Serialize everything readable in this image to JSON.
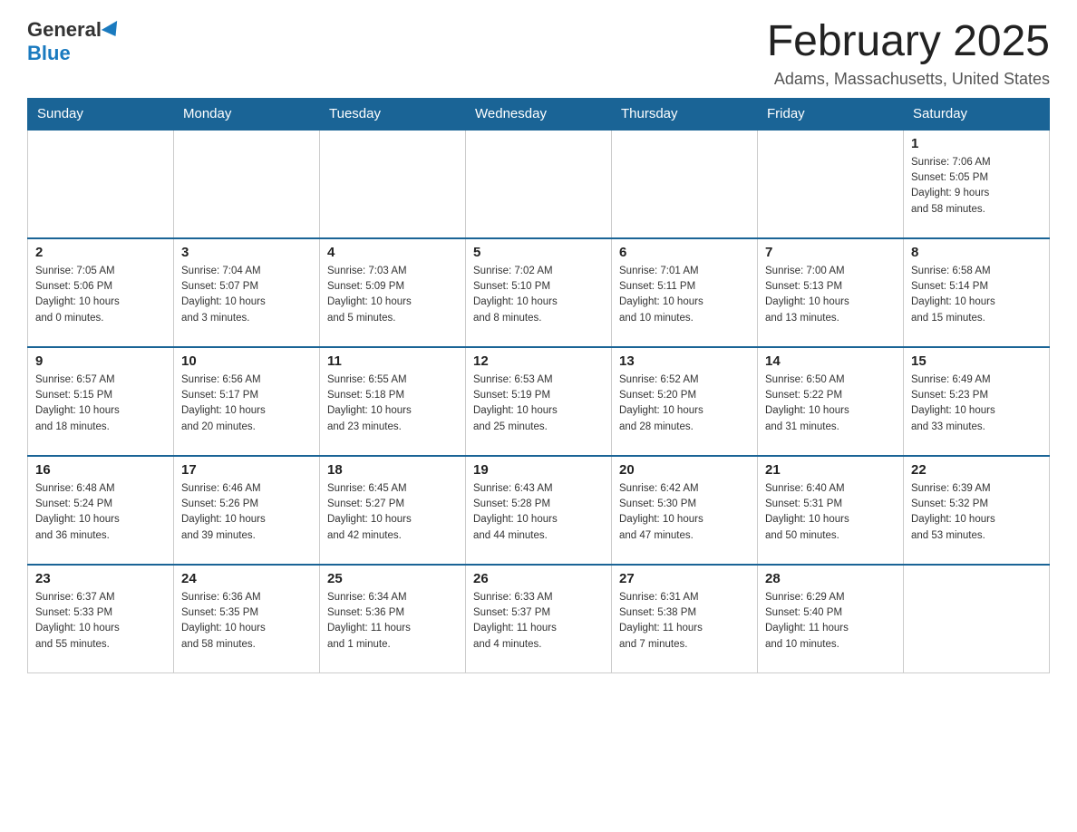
{
  "header": {
    "logo_general": "General",
    "logo_blue": "Blue",
    "month_title": "February 2025",
    "location": "Adams, Massachusetts, United States"
  },
  "days_of_week": [
    "Sunday",
    "Monday",
    "Tuesday",
    "Wednesday",
    "Thursday",
    "Friday",
    "Saturday"
  ],
  "weeks": [
    [
      {
        "day": "",
        "info": ""
      },
      {
        "day": "",
        "info": ""
      },
      {
        "day": "",
        "info": ""
      },
      {
        "day": "",
        "info": ""
      },
      {
        "day": "",
        "info": ""
      },
      {
        "day": "",
        "info": ""
      },
      {
        "day": "1",
        "info": "Sunrise: 7:06 AM\nSunset: 5:05 PM\nDaylight: 9 hours\nand 58 minutes."
      }
    ],
    [
      {
        "day": "2",
        "info": "Sunrise: 7:05 AM\nSunset: 5:06 PM\nDaylight: 10 hours\nand 0 minutes."
      },
      {
        "day": "3",
        "info": "Sunrise: 7:04 AM\nSunset: 5:07 PM\nDaylight: 10 hours\nand 3 minutes."
      },
      {
        "day": "4",
        "info": "Sunrise: 7:03 AM\nSunset: 5:09 PM\nDaylight: 10 hours\nand 5 minutes."
      },
      {
        "day": "5",
        "info": "Sunrise: 7:02 AM\nSunset: 5:10 PM\nDaylight: 10 hours\nand 8 minutes."
      },
      {
        "day": "6",
        "info": "Sunrise: 7:01 AM\nSunset: 5:11 PM\nDaylight: 10 hours\nand 10 minutes."
      },
      {
        "day": "7",
        "info": "Sunrise: 7:00 AM\nSunset: 5:13 PM\nDaylight: 10 hours\nand 13 minutes."
      },
      {
        "day": "8",
        "info": "Sunrise: 6:58 AM\nSunset: 5:14 PM\nDaylight: 10 hours\nand 15 minutes."
      }
    ],
    [
      {
        "day": "9",
        "info": "Sunrise: 6:57 AM\nSunset: 5:15 PM\nDaylight: 10 hours\nand 18 minutes."
      },
      {
        "day": "10",
        "info": "Sunrise: 6:56 AM\nSunset: 5:17 PM\nDaylight: 10 hours\nand 20 minutes."
      },
      {
        "day": "11",
        "info": "Sunrise: 6:55 AM\nSunset: 5:18 PM\nDaylight: 10 hours\nand 23 minutes."
      },
      {
        "day": "12",
        "info": "Sunrise: 6:53 AM\nSunset: 5:19 PM\nDaylight: 10 hours\nand 25 minutes."
      },
      {
        "day": "13",
        "info": "Sunrise: 6:52 AM\nSunset: 5:20 PM\nDaylight: 10 hours\nand 28 minutes."
      },
      {
        "day": "14",
        "info": "Sunrise: 6:50 AM\nSunset: 5:22 PM\nDaylight: 10 hours\nand 31 minutes."
      },
      {
        "day": "15",
        "info": "Sunrise: 6:49 AM\nSunset: 5:23 PM\nDaylight: 10 hours\nand 33 minutes."
      }
    ],
    [
      {
        "day": "16",
        "info": "Sunrise: 6:48 AM\nSunset: 5:24 PM\nDaylight: 10 hours\nand 36 minutes."
      },
      {
        "day": "17",
        "info": "Sunrise: 6:46 AM\nSunset: 5:26 PM\nDaylight: 10 hours\nand 39 minutes."
      },
      {
        "day": "18",
        "info": "Sunrise: 6:45 AM\nSunset: 5:27 PM\nDaylight: 10 hours\nand 42 minutes."
      },
      {
        "day": "19",
        "info": "Sunrise: 6:43 AM\nSunset: 5:28 PM\nDaylight: 10 hours\nand 44 minutes."
      },
      {
        "day": "20",
        "info": "Sunrise: 6:42 AM\nSunset: 5:30 PM\nDaylight: 10 hours\nand 47 minutes."
      },
      {
        "day": "21",
        "info": "Sunrise: 6:40 AM\nSunset: 5:31 PM\nDaylight: 10 hours\nand 50 minutes."
      },
      {
        "day": "22",
        "info": "Sunrise: 6:39 AM\nSunset: 5:32 PM\nDaylight: 10 hours\nand 53 minutes."
      }
    ],
    [
      {
        "day": "23",
        "info": "Sunrise: 6:37 AM\nSunset: 5:33 PM\nDaylight: 10 hours\nand 55 minutes."
      },
      {
        "day": "24",
        "info": "Sunrise: 6:36 AM\nSunset: 5:35 PM\nDaylight: 10 hours\nand 58 minutes."
      },
      {
        "day": "25",
        "info": "Sunrise: 6:34 AM\nSunset: 5:36 PM\nDaylight: 11 hours\nand 1 minute."
      },
      {
        "day": "26",
        "info": "Sunrise: 6:33 AM\nSunset: 5:37 PM\nDaylight: 11 hours\nand 4 minutes."
      },
      {
        "day": "27",
        "info": "Sunrise: 6:31 AM\nSunset: 5:38 PM\nDaylight: 11 hours\nand 7 minutes."
      },
      {
        "day": "28",
        "info": "Sunrise: 6:29 AM\nSunset: 5:40 PM\nDaylight: 11 hours\nand 10 minutes."
      },
      {
        "day": "",
        "info": ""
      }
    ]
  ]
}
